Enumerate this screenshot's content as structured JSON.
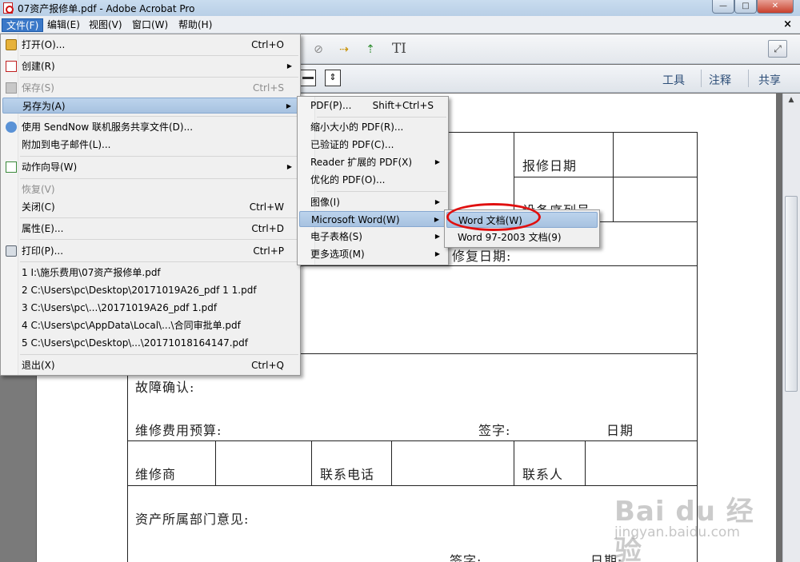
{
  "window": {
    "title": "07资产报修单.pdf - Adobe Acrobat Pro",
    "minimize_icon": "minimize-icon",
    "maximize_icon": "maximize-icon",
    "close_icon": "close-icon",
    "close_glyph": "✕",
    "minimize_glyph": "—",
    "maximize_glyph": "□"
  },
  "menubar": {
    "items": [
      "文件(F)",
      "编辑(E)",
      "视图(V)",
      "窗口(W)",
      "帮助(H)"
    ],
    "doc_close": "×"
  },
  "toolbar": {
    "text_tool": "TI",
    "expand_glyph": "⤢",
    "links": [
      "工具",
      "注释",
      "共享"
    ]
  },
  "file_menu": {
    "items": [
      {
        "label": "打开(O)...",
        "shortcut": "Ctrl+O",
        "icon": "open-folder-icon"
      },
      {
        "label": "创建(R)",
        "submenu": true,
        "icon": "create-pdf-icon"
      },
      {
        "label": "保存(S)",
        "shortcut": "Ctrl+S",
        "disabled": true,
        "icon": "save-icon"
      },
      {
        "label": "另存为(A)",
        "submenu": true,
        "highlighted": true
      },
      {
        "label": "使用 SendNow 联机服务共享文件(D)...",
        "icon": "sendnow-globe-icon"
      },
      {
        "label": "附加到电子邮件(L)..."
      },
      {
        "label": "动作向导(W)",
        "submenu": true,
        "icon": "action-wizard-icon"
      },
      {
        "label": "恢复(V)",
        "disabled": true
      },
      {
        "label": "关闭(C)",
        "shortcut": "Ctrl+W"
      },
      {
        "label": "属性(E)...",
        "shortcut": "Ctrl+D"
      },
      {
        "label": "打印(P)...",
        "shortcut": "Ctrl+P",
        "icon": "printer-icon"
      },
      {
        "label": "1 I:\\施乐费用\\07资产报修单.pdf"
      },
      {
        "label": "2 C:\\Users\\pc\\Desktop\\20171019A26_pdf 1 1.pdf"
      },
      {
        "label": "3 C:\\Users\\pc\\...\\20171019A26_pdf 1.pdf"
      },
      {
        "label": "4 C:\\Users\\pc\\AppData\\Local\\...\\合同审批单.pdf"
      },
      {
        "label": "5 C:\\Users\\pc\\Desktop\\...\\20171018164147.pdf"
      },
      {
        "label": "退出(X)",
        "shortcut": "Ctrl+Q"
      }
    ]
  },
  "save_as_menu": {
    "items": [
      {
        "label": "PDF(P)...",
        "shortcut": "Shift+Ctrl+S"
      },
      {
        "label": "缩小大小的 PDF(R)..."
      },
      {
        "label": "已验证的 PDF(C)..."
      },
      {
        "label": "Reader 扩展的 PDF(X)",
        "submenu": true
      },
      {
        "label": "优化的 PDF(O)..."
      },
      {
        "label": "图像(I)",
        "submenu": true
      },
      {
        "label": "Microsoft Word(W)",
        "submenu": true,
        "highlighted": true
      },
      {
        "label": "电子表格(S)",
        "submenu": true
      },
      {
        "label": "更多选项(M)",
        "submenu": true
      }
    ]
  },
  "word_menu": {
    "items": [
      {
        "label": "Word 文档(W)",
        "highlighted": true
      },
      {
        "label": "Word 97-2003 文档(9)"
      }
    ]
  },
  "form": {
    "repair_date": "报修日期",
    "device_serial": "设备序列号",
    "repair_done_date": "修复日期:",
    "fault_confirm": "故障确认:",
    "budget": "维修费用预算:",
    "sign1": "签字:",
    "date1": "日期",
    "vendor": "维修商",
    "phone": "联系电话",
    "contact": "联系人",
    "dept_opinion": "资产所属部门意见:",
    "sign2": "签字:",
    "date2": "日期:"
  },
  "watermark": {
    "brand": "Bai du 经验",
    "url": "jingyan.baidu.com"
  },
  "colors": {
    "highlight": "#a7c2e0",
    "annotation_circle": "#e01010",
    "menu_active": "#3a78c8"
  }
}
